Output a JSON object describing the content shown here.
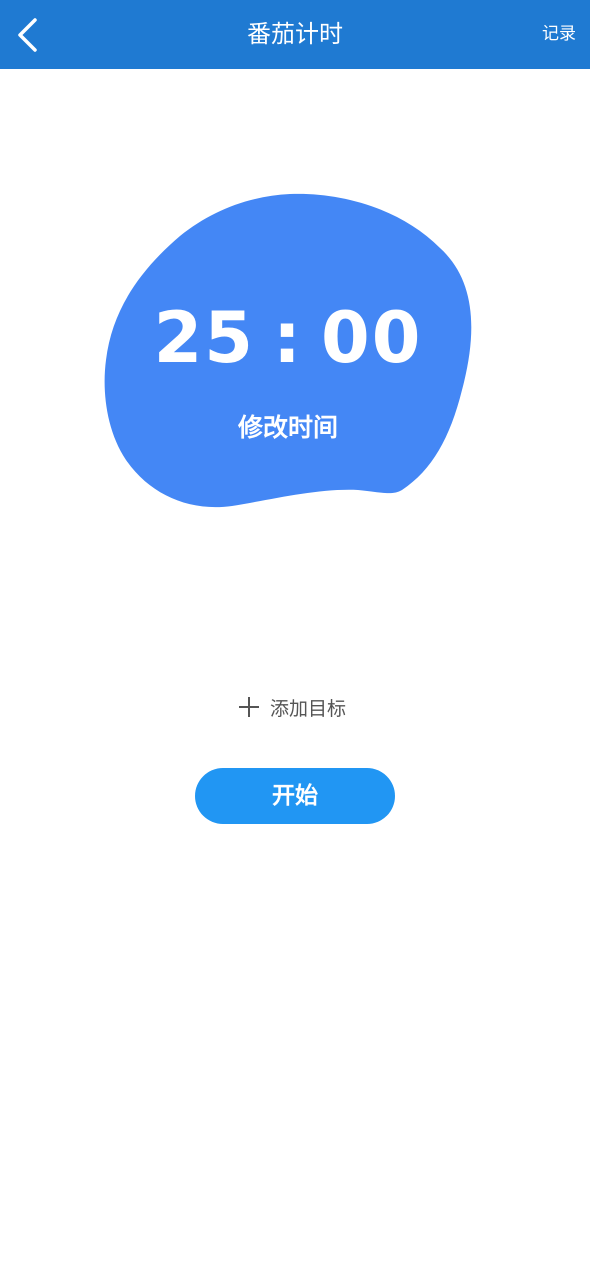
{
  "header": {
    "title": "番茄计时",
    "record_label": "记录",
    "back_icon": "chevron-left-icon",
    "background_color": "#1f7ad2"
  },
  "timer": {
    "minutes": "25",
    "separator": ":",
    "seconds": "00",
    "edit_label": "修改时间",
    "blob_color": "#4487f5"
  },
  "goal": {
    "icon": "plus-icon",
    "label": "添加目标"
  },
  "start_button": {
    "label": "开始",
    "color": "#2196f3"
  }
}
